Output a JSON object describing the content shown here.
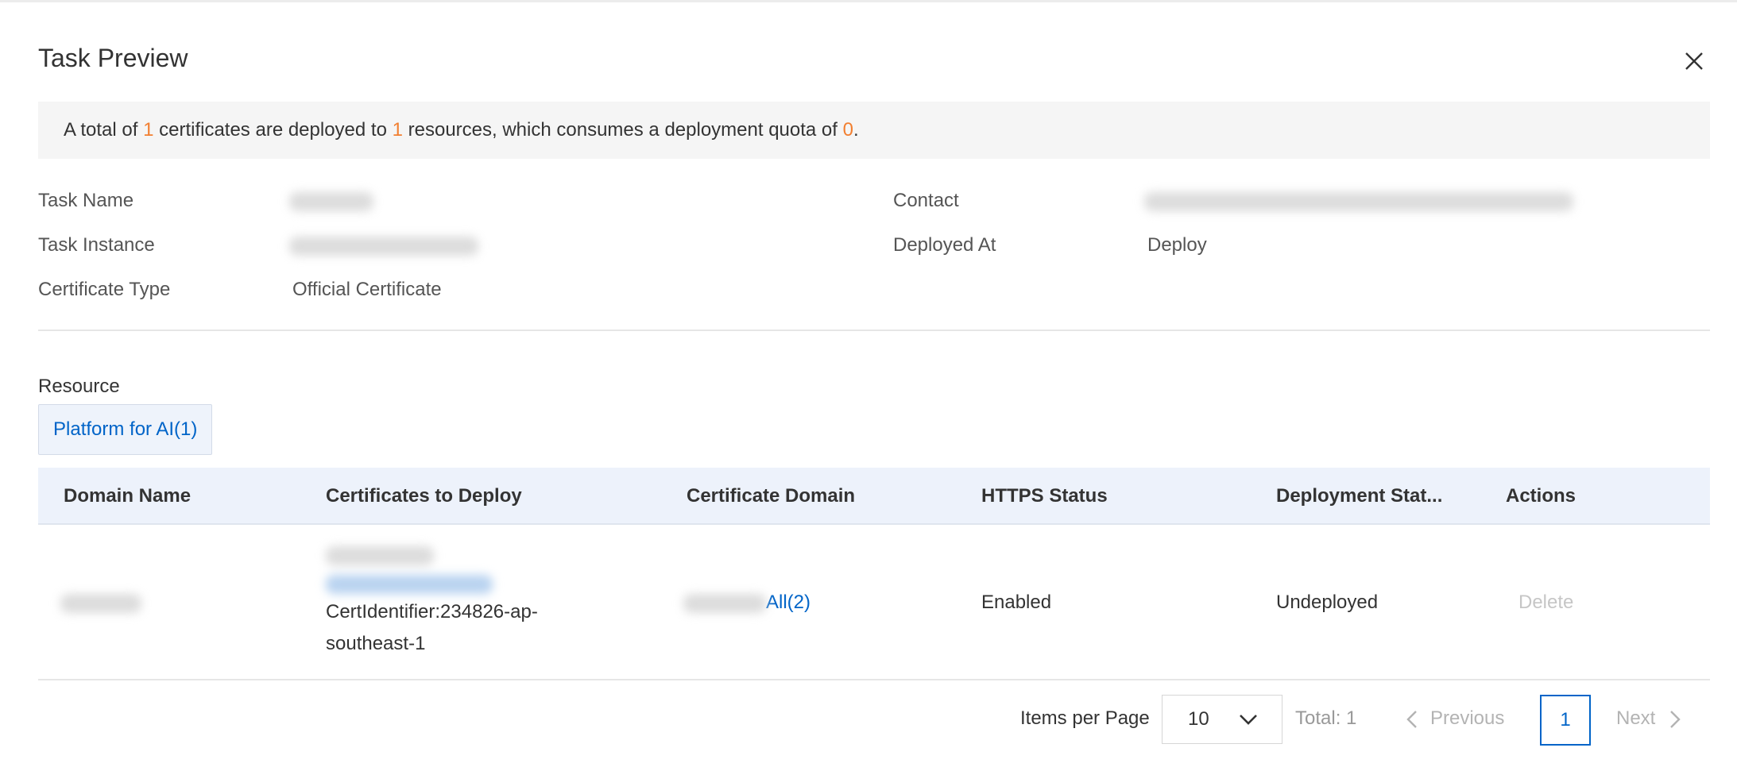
{
  "dialog": {
    "title": "Task Preview"
  },
  "notice": {
    "prefix": "A total of ",
    "certificates_count": "1",
    "middle1": " certificates are deployed to ",
    "resources_count": "1",
    "middle2": " resources, which consumes a deployment quota of ",
    "quota": "0",
    "suffix": "."
  },
  "info": {
    "task_name_label": "Task Name",
    "task_instance_label": "Task Instance",
    "certificate_type_label": "Certificate Type",
    "certificate_type_value": "Official Certificate",
    "contact_label": "Contact",
    "deployed_at_label": "Deployed At",
    "deployed_at_value": "Deploy"
  },
  "resource": {
    "label": "Resource",
    "tab_label": "Platform for AI(1)"
  },
  "table": {
    "columns": [
      "Domain Name",
      "Certificates to Deploy",
      "Certificate Domain",
      "HTTPS Status",
      "Deployment Stat...",
      "Actions"
    ],
    "rows": [
      {
        "cert_identifier_line1": "CertIdentifier:234826-ap-",
        "cert_identifier_line2": "southeast-1",
        "cert_domain_link": "All(2)",
        "https_status": "Enabled",
        "deployment_status": "Undeployed",
        "action": "Delete"
      }
    ]
  },
  "pagination": {
    "items_per_page_label": "Items per Page",
    "page_size": "10",
    "total": "Total: 1",
    "previous": "Previous",
    "current_page": "1",
    "next": "Next"
  },
  "colors": {
    "accent": "#0064c8",
    "highlight": "#f27f30"
  }
}
